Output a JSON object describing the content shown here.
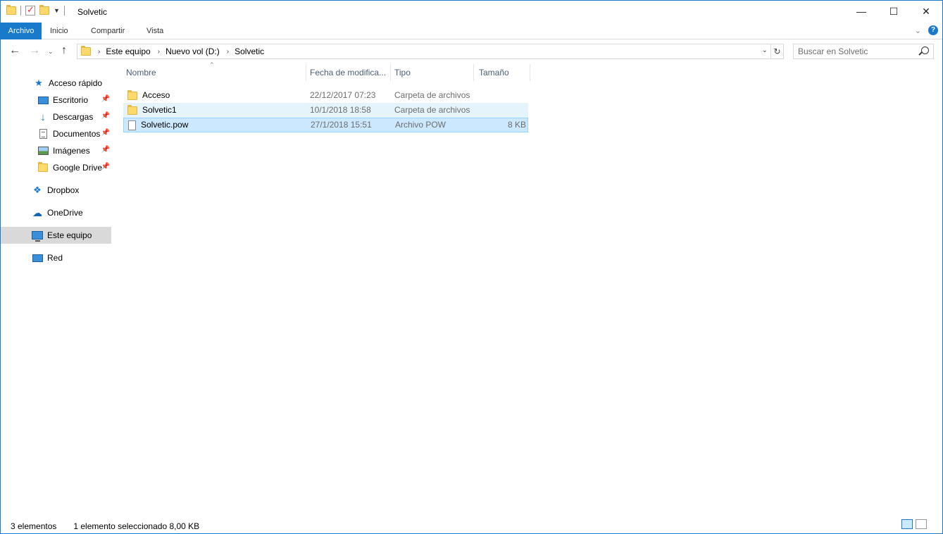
{
  "window": {
    "title": "Solvetic",
    "controls": {
      "minimize": "—",
      "maximize": "☐",
      "close": "✕"
    }
  },
  "ribbon": {
    "tabs": [
      "Archivo",
      "Inicio",
      "Compartir",
      "Vista"
    ],
    "help": "?"
  },
  "address": {
    "crumbs": [
      "Este equipo",
      "Nuevo vol (D:)",
      "Solvetic"
    ],
    "search_placeholder": "Buscar en Solvetic"
  },
  "sidebar": {
    "items": [
      {
        "label": "Acceso rápido",
        "icon": "star-icon"
      },
      {
        "label": "Escritorio",
        "icon": "desktop-icon",
        "pinned": true
      },
      {
        "label": "Descargas",
        "icon": "download-icon",
        "pinned": true
      },
      {
        "label": "Documentos",
        "icon": "documents-icon",
        "pinned": true
      },
      {
        "label": "Imágenes",
        "icon": "pictures-icon",
        "pinned": true
      },
      {
        "label": "Google Drive",
        "icon": "folder-icon",
        "pinned": true
      },
      {
        "label": "Dropbox",
        "icon": "dropbox-icon"
      },
      {
        "label": "OneDrive",
        "icon": "onedrive-icon"
      },
      {
        "label": "Este equipo",
        "icon": "this-pc-icon",
        "selected": true
      },
      {
        "label": "Red",
        "icon": "network-icon"
      }
    ]
  },
  "columns": {
    "name": "Nombre",
    "date": "Fecha de modifica...",
    "type": "Tipo",
    "size": "Tamaño"
  },
  "files": [
    {
      "name": "Acceso",
      "date": "22/12/2017 07:23",
      "type": "Carpeta de archivos",
      "size": "",
      "kind": "folder"
    },
    {
      "name": "Solvetic1",
      "date": "10/1/2018 18:58",
      "type": "Carpeta de archivos",
      "size": "",
      "kind": "folder",
      "state": "hover"
    },
    {
      "name": "Solvetic.pow",
      "date": "27/1/2018 15:51",
      "type": "Archivo POW",
      "size": "8 KB",
      "kind": "file",
      "state": "selected"
    }
  ],
  "status": {
    "count": "3 elementos",
    "selection": "1 elemento seleccionado  8,00 KB"
  },
  "colors": {
    "accent": "#1979ca",
    "selected_row": "#cce8ff",
    "hover_row": "#e5f3fb"
  }
}
